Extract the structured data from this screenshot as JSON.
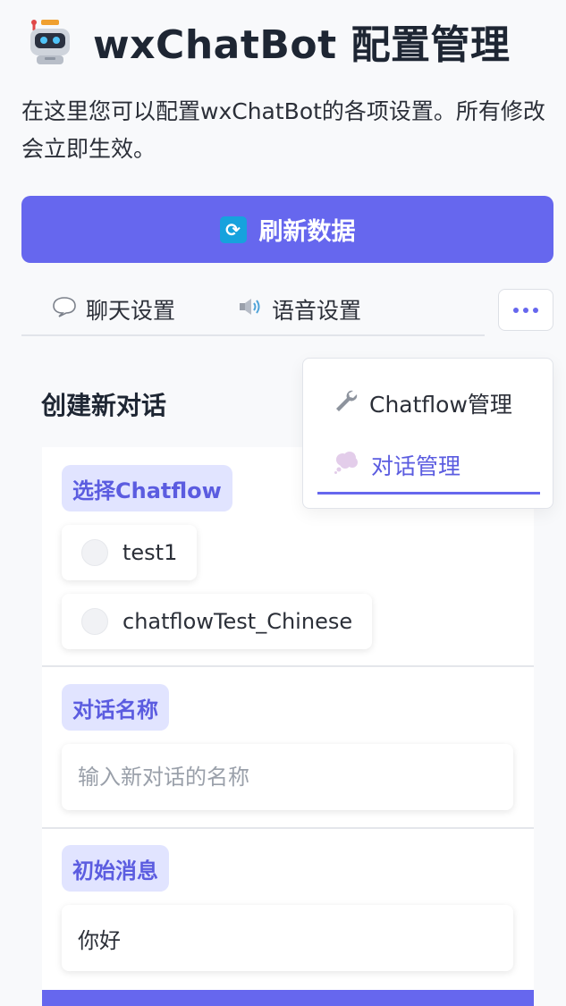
{
  "header": {
    "title": "wxChatBot 配置管理",
    "description": "在这里您可以配置wxChatBot的各项设置。所有修改会立即生效。",
    "icon": "robot-icon"
  },
  "refresh_button": {
    "label": "刷新数据",
    "icon": "refresh-icon"
  },
  "tabs": [
    {
      "label": "聊天设置",
      "icon": "speech-bubble-icon"
    },
    {
      "label": "语音设置",
      "icon": "speaker-icon"
    }
  ],
  "more_button": {
    "icon": "ellipsis-icon"
  },
  "dropdown": {
    "items": [
      {
        "label": "Chatflow管理",
        "icon": "wrench-icon"
      },
      {
        "label": "对话管理",
        "icon": "thought-bubble-icon",
        "active": true
      }
    ]
  },
  "section": {
    "title": "创建新对话",
    "chatflow": {
      "label": "选择Chatflow",
      "options": [
        "test1",
        "chatflowTest_Chinese"
      ]
    },
    "name": {
      "label": "对话名称",
      "placeholder": "输入新对话的名称",
      "value": ""
    },
    "initial_message": {
      "label": "初始消息",
      "value": "你好"
    }
  },
  "colors": {
    "accent": "#6667ee",
    "label_bg": "#e1e4ff",
    "refresh_icon_bg": "#16a2dd"
  }
}
